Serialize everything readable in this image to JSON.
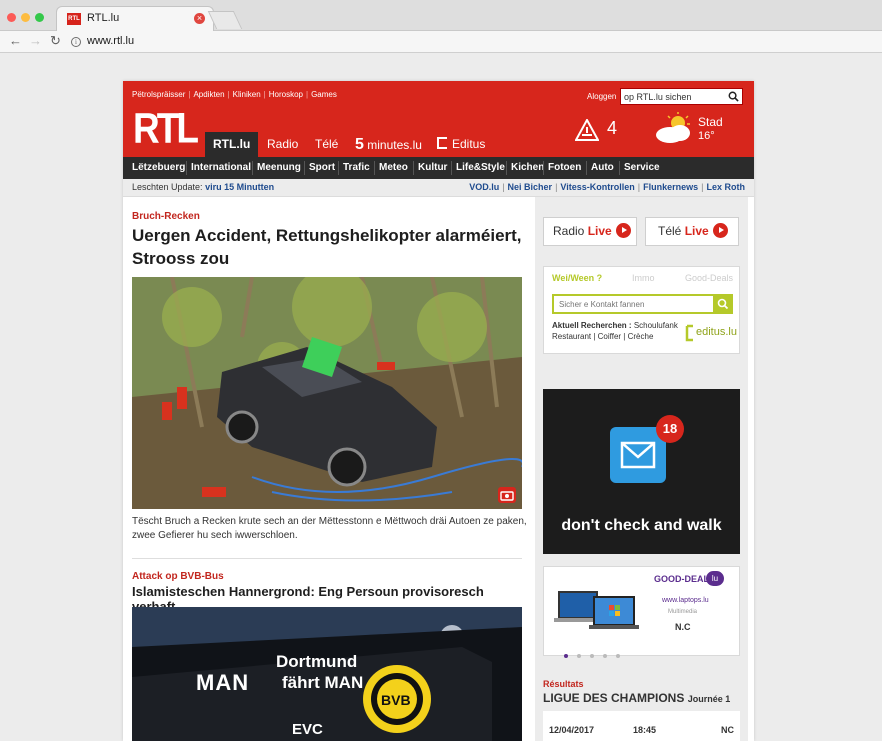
{
  "browser": {
    "tab_title": "RTL.lu",
    "tab_favicon_text": "RTL",
    "url": "www.rtl.lu",
    "colors": {
      "close": "#e0463f",
      "red": "#fc5b57",
      "yellow": "#fdbc40",
      "green": "#34c84a"
    }
  },
  "header": {
    "toplinks": [
      "Pëtrolspräisser",
      "Apdikten",
      "Kliniken",
      "Horoskop",
      "Games"
    ],
    "login": "Aloggen",
    "search_value": "op RTL.lu sichen",
    "logo": "RTL",
    "tabs": [
      {
        "label": "RTL.lu",
        "active": true
      },
      {
        "label": "Radio"
      },
      {
        "label": "Télé"
      },
      {
        "prefix": "5",
        "label": "minutes.lu"
      },
      {
        "label": "Editus"
      }
    ],
    "warning_count": "4",
    "weather": {
      "city": "Stad",
      "temp": "16°"
    },
    "brand_color": "#d7261c"
  },
  "nav": [
    "Lëtzebuerg",
    "International",
    "Meenung",
    "Sport",
    "Trafic",
    "Meteo",
    "Kultur",
    "Life&Style",
    "Kichen",
    "Fotoen",
    "Auto",
    "Service"
  ],
  "update_bar": {
    "label": "Leschten Update:",
    "value": "viru 15 Minutten",
    "links": [
      "VOD.lu",
      "Nei Bicher",
      "Vitess-Kontrollen",
      "Flunkernews",
      "Lex Roth"
    ]
  },
  "articles": [
    {
      "kicker": "Bruch-Recken",
      "title": "Uergen Accident, Rettungshelikopter alarméiert, Strooss zou",
      "caption": "Tëscht Bruch a Recken krute sech an der Mëttesstonn e Mëttwoch dräi Autoen ze paken, zwee Gefierer hu sech iwwerschloen."
    },
    {
      "kicker": "Attack op BVB-Bus",
      "title": "Islamisteschen Hannergrond: Eng Persoun provisoresch verhaft"
    }
  ],
  "bus_photo_text": {
    "brand": "Dortmund",
    "slogan": "fährt MAN",
    "mark": "MAN",
    "sponsor": "EVC"
  },
  "sidebar": {
    "radio": {
      "label": "Radio",
      "live": "Live"
    },
    "tele": {
      "label": "Télé",
      "live": "Live"
    },
    "weiwoen": {
      "tabs": [
        "Wei/Ween ?",
        "Immo",
        "Good-Deals"
      ],
      "placeholder": "Sicher e Kontakt fannen",
      "recherchen_label": "Aktuell Recherchen :",
      "recherchen": "Schoulufank",
      "recherchen_more": "Restaurant | Coiffer | Crèche",
      "logo": "editus.lu"
    },
    "ad1": {
      "badge": "18",
      "slogan": "don't check and walk"
    },
    "ad2": {
      "title": "GOOD-DEALS",
      "badge": "lu",
      "site": "www.laptops.lu",
      "category": "Multimedia",
      "price": "N.C"
    },
    "results": {
      "kicker": "Résultats",
      "title": "LIGUE DES CHAMPIONS",
      "journee": "Journée 1",
      "date": "12/04/2017",
      "time": "18:45",
      "score": "NC"
    }
  }
}
